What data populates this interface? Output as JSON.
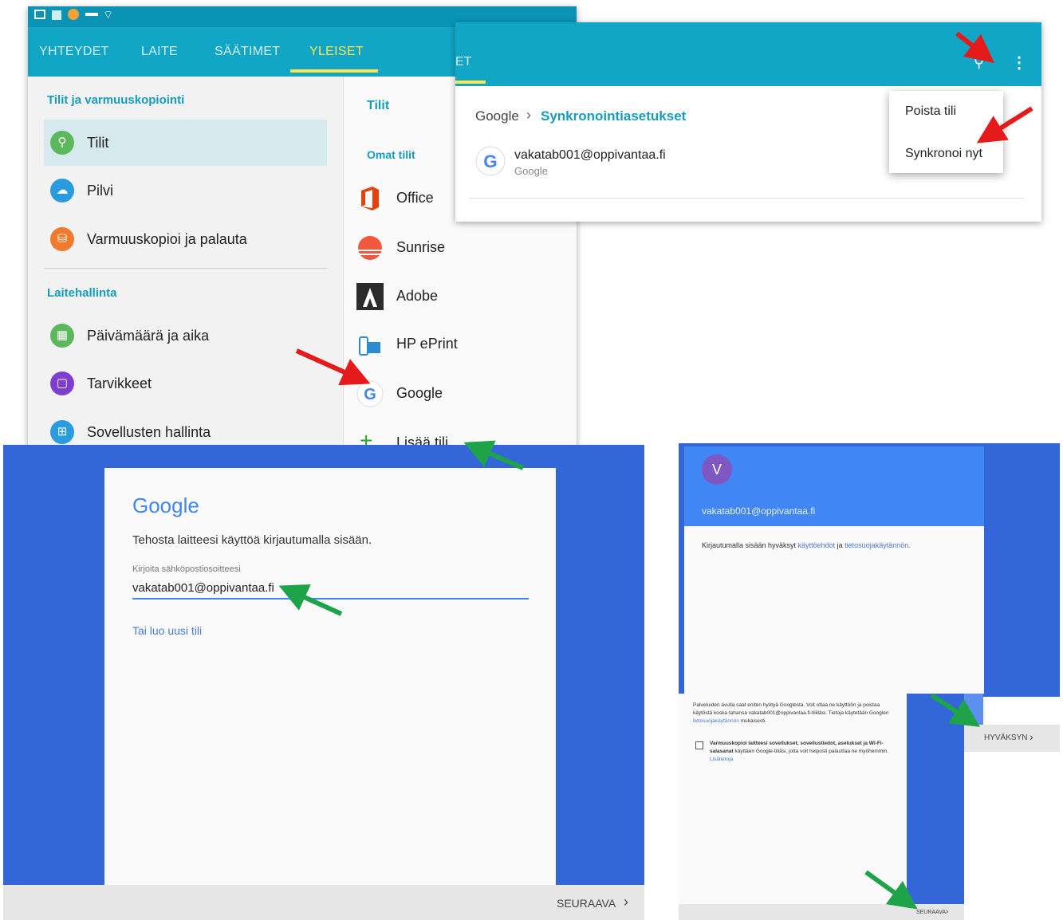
{
  "settings": {
    "tabs": [
      "YHTEYDET",
      "LAITE",
      "SÄÄTIMET",
      "YLEISET"
    ],
    "active_tab": "YLEISET",
    "section_accounts": "Tilit ja varmuuskopiointi",
    "items_accounts": [
      {
        "label": "Tilit",
        "icon": "key-icon",
        "color": "#5cb85c"
      },
      {
        "label": "Pilvi",
        "icon": "cloud-icon",
        "color": "#2b9be0"
      },
      {
        "label": "Varmuuskopioi ja palauta",
        "icon": "backup-icon",
        "color": "#f07b2e"
      }
    ],
    "section_device": "Laitehallinta",
    "items_device": [
      {
        "label": "Päivämäärä ja aika",
        "icon": "calendar-icon",
        "color": "#5cb85c"
      },
      {
        "label": "Tarvikkeet",
        "icon": "accessory-icon",
        "color": "#7e3fd1"
      },
      {
        "label": "Sovellusten hallinta",
        "icon": "apps-icon",
        "color": "#2b9be0"
      }
    ],
    "right_title": "Tilit",
    "right_section": "Omat tilit",
    "accounts": [
      "Office",
      "Sunrise",
      "Adobe",
      "HP ePrint",
      "Google"
    ],
    "add_account": "Lisää tili"
  },
  "sync": {
    "tab_fragment": "ET",
    "breadcrumb_root": "Google",
    "breadcrumb_current": "Synkronointiasetukset",
    "account_email": "vakatab001@oppivantaa.fi",
    "account_type": "Google",
    "menu": [
      "Poista tili",
      "Synkronoi nyt"
    ]
  },
  "signin": {
    "logo": "Google",
    "subtitle": "Tehosta laitteesi käyttöä kirjautumalla sisään.",
    "input_label": "Kirjoita sähköpostiosoitteesi",
    "input_value": "vakatab001@oppivantaa.fi",
    "create_link": "Tai luo uusi tili",
    "next_button": "SEURAAVA"
  },
  "consent": {
    "avatar_letter": "V",
    "email": "vakatab001@oppivantaa.fi",
    "terms_prefix": "Kirjautumalla sisään hyväksyt",
    "terms_link": "käyttöehdot",
    "terms_and": "ja",
    "privacy_link": "tietosuojakäytännön.",
    "accept_button": "HYVÄKSYN",
    "services_text": "Palveluiden avulla saat eniten hyötyä Googlesta. Voit ottaa ne käyttöön ja poistaa käytöstä koska tahansa vakatab001@oppivantaa.fi-tililläsi. Tietoja käytetään Googlen",
    "services_link": "tietosuojakäytännön",
    "services_suffix": "mukaisesti.",
    "backup_bold": "Varmuuskopioi laitteesi sovellukset, sovellustiedot, asetukset ja Wi-Fi-salasanat",
    "backup_text": "käyttäen Google-tiliäsi, jotta voit helposti palauttaa ne myöhemmin.",
    "backup_link": "Lisätietoja",
    "next_button": "SEURAAVA"
  }
}
